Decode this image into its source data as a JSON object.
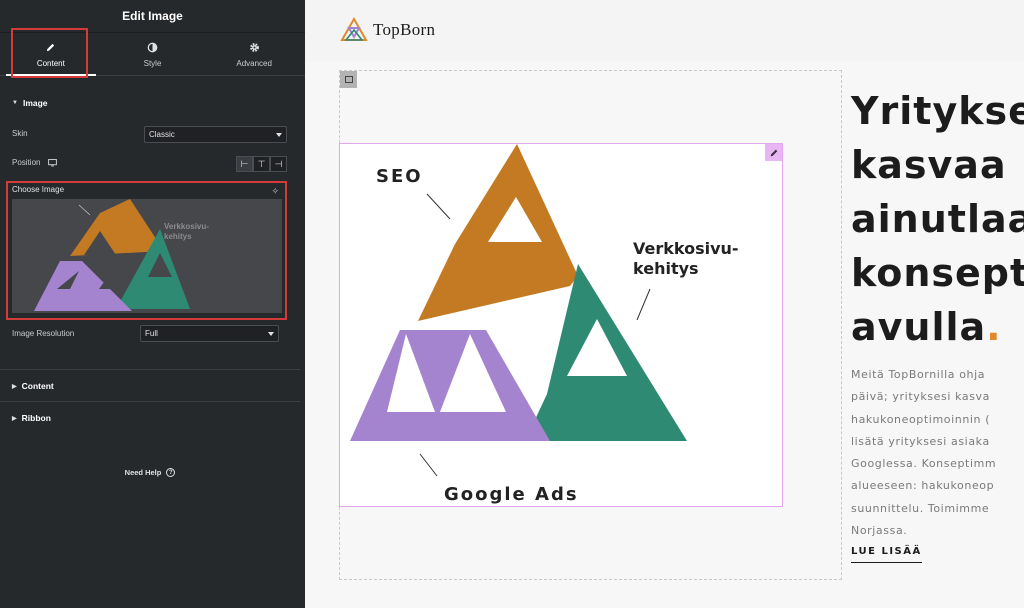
{
  "panel": {
    "title": "Edit Image",
    "tabs": [
      {
        "label": "Content",
        "icon": "pencil-icon",
        "active": true
      },
      {
        "label": "Style",
        "icon": "half-circle-icon",
        "active": false
      },
      {
        "label": "Advanced",
        "icon": "gear-icon",
        "active": false
      }
    ],
    "image_section": {
      "title": "Image",
      "skin_label": "Skin",
      "skin_value": "Classic",
      "position_label": "Position",
      "position_options": [
        "left-align-icon",
        "top-align-icon",
        "right-align-icon"
      ],
      "choose_image_label": "Choose Image",
      "resolution_label": "Image Resolution",
      "resolution_value": "Full"
    },
    "collapsed_sections": [
      "Content",
      "Ribbon"
    ],
    "need_help": "Need Help",
    "highlight_color": "#d33a3a"
  },
  "site": {
    "logo_text": "TopBorn",
    "image": {
      "labels": {
        "seo": "SEO",
        "web": "Verkkosivu-\nkehitys",
        "web_line1": "Verkkosivu-",
        "web_line2": "kehitys",
        "ads": "Google Ads"
      },
      "colors": {
        "orange": "#c47a22",
        "green": "#2f8a74",
        "purple": "#a584cf"
      }
    },
    "heading": {
      "lines": [
        "Yritykse",
        "kasvaa",
        "ainutlaa",
        "konsept",
        "avull"
      ],
      "last_word": "avulla",
      "dot": ".",
      "dot_color": "#e28a2b"
    },
    "paragraph_lines": [
      "Meitä TopBornilla ohja",
      "päivä; yrityksesi kasva",
      "hakukoneoptimoinnin (",
      "lisätä yrityksesi asiaka",
      "Googlessa. Konseptimm",
      "alueeseen: hakukoneop",
      "suunnittelu. Toimimme",
      "Norjassa."
    ],
    "read_more": "LUE LISÄÄ"
  }
}
